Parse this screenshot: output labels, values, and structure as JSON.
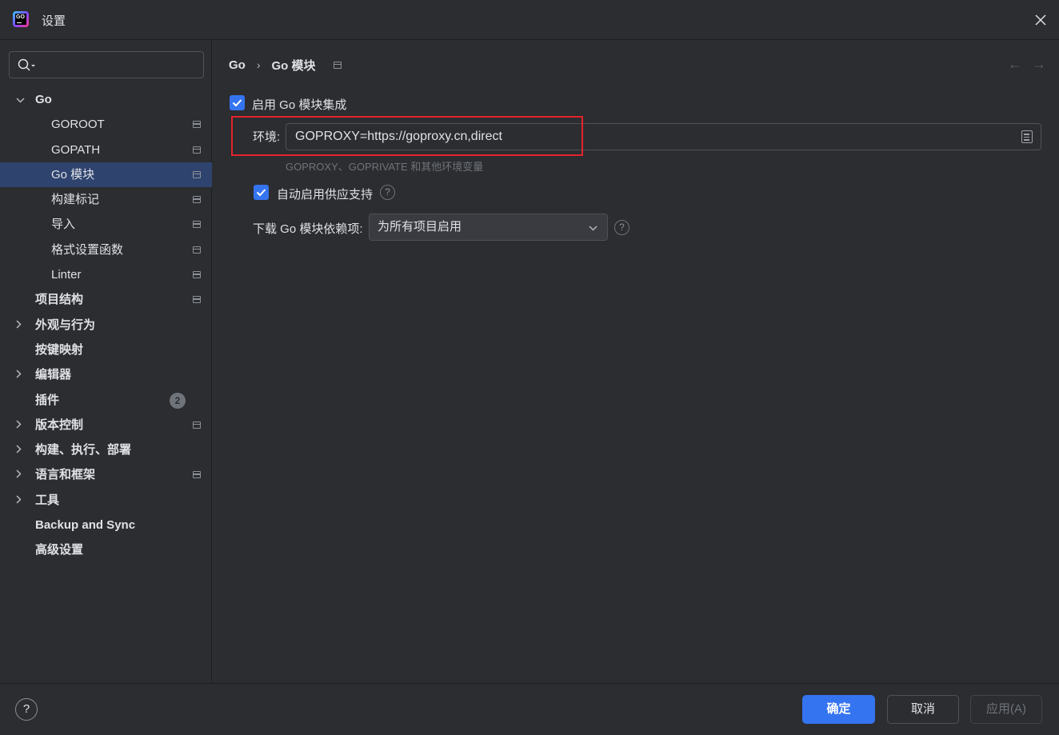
{
  "window": {
    "title": "设置",
    "logo_text": "GO"
  },
  "sidebar": {
    "search": {
      "placeholder": "",
      "value": ""
    },
    "items": [
      {
        "label": "Go",
        "level": 0,
        "expandable": true,
        "expanded": true,
        "bold": true
      },
      {
        "label": "GOROOT",
        "level": 1,
        "page_icon": true
      },
      {
        "label": "GOPATH",
        "level": 1,
        "page_icon": true
      },
      {
        "label": "Go 模块",
        "level": 1,
        "page_icon": true,
        "selected": true
      },
      {
        "label": "构建标记",
        "level": 1,
        "page_icon": true
      },
      {
        "label": "导入",
        "level": 1,
        "page_icon": true
      },
      {
        "label": "格式设置函数",
        "level": 1,
        "page_icon": true
      },
      {
        "label": "Linter",
        "level": 1,
        "page_icon": true
      },
      {
        "label": "项目结构",
        "level": 0,
        "bold": true,
        "page_icon": true
      },
      {
        "label": "外观与行为",
        "level": 0,
        "expandable": true,
        "bold": true
      },
      {
        "label": "按键映射",
        "level": 0,
        "bold": true
      },
      {
        "label": "编辑器",
        "level": 0,
        "expandable": true,
        "bold": true
      },
      {
        "label": "插件",
        "level": 0,
        "bold": true,
        "badge": "2"
      },
      {
        "label": "版本控制",
        "level": 0,
        "expandable": true,
        "bold": true,
        "page_icon": true
      },
      {
        "label": "构建、执行、部署",
        "level": 0,
        "expandable": true,
        "bold": true
      },
      {
        "label": "语言和框架",
        "level": 0,
        "expandable": true,
        "bold": true,
        "page_icon": true
      },
      {
        "label": "工具",
        "level": 0,
        "expandable": true,
        "bold": true
      },
      {
        "label": "Backup and Sync",
        "level": 0,
        "bold": true
      },
      {
        "label": "高级设置",
        "level": 0,
        "bold": true
      }
    ]
  },
  "main": {
    "breadcrumb": [
      "Go",
      "Go 模块"
    ],
    "nav_back": "←",
    "nav_forward": "→",
    "enable_integration": {
      "label": "启用 Go 模块集成",
      "checked": true
    },
    "environment": {
      "label": "环境:",
      "value": "GOPROXY=https://goproxy.cn,direct",
      "hint": "GOPROXY、GOPRIVATE 和其他环境变量"
    },
    "vendoring": {
      "label": "自动启用供应支持",
      "checked": true
    },
    "download": {
      "label": "下载 Go 模块依赖项:",
      "selected": "为所有项目启用"
    }
  },
  "footer": {
    "help": "?",
    "ok": "确定",
    "cancel": "取消",
    "apply": "应用(A)"
  },
  "colors": {
    "accent": "#3574f0",
    "selection": "#2e436e",
    "highlight": "#e5232b",
    "background": "#2b2d30"
  }
}
